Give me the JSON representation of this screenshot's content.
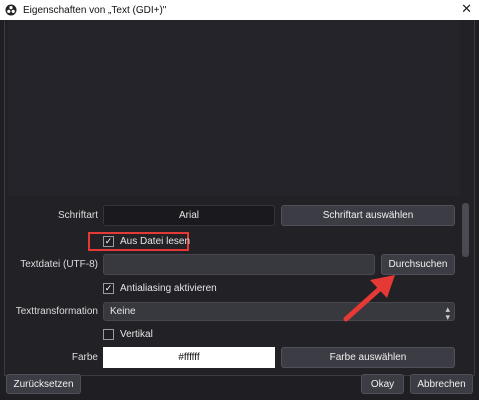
{
  "window": {
    "title": "Eigenschaften von „Text (GDI+)\"",
    "close_glyph": "✕"
  },
  "font": {
    "label": "Schriftart",
    "value": "Arial",
    "select_button": "Schriftart auswählen"
  },
  "read_from_file": {
    "label": "Aus Datei lesen",
    "checked": true
  },
  "text_file": {
    "label": "Textdatei (UTF-8)",
    "value": "",
    "browse_button": "Durchsuchen"
  },
  "antialiasing": {
    "label": "Antialiasing aktivieren",
    "checked": true
  },
  "text_transform": {
    "label": "Texttransformation",
    "value": "Keine"
  },
  "vertical": {
    "label": "Vertikal",
    "checked": false
  },
  "color": {
    "label": "Farbe",
    "value": "#ffffff",
    "select_button": "Farbe auswählen"
  },
  "footer": {
    "reset_button": "Zurücksetzen",
    "ok_button": "Okay",
    "cancel_button": "Abbrechen"
  },
  "colors": {
    "highlight": "#e53935",
    "arrow": "#e53935",
    "background": "#1f1f23"
  }
}
